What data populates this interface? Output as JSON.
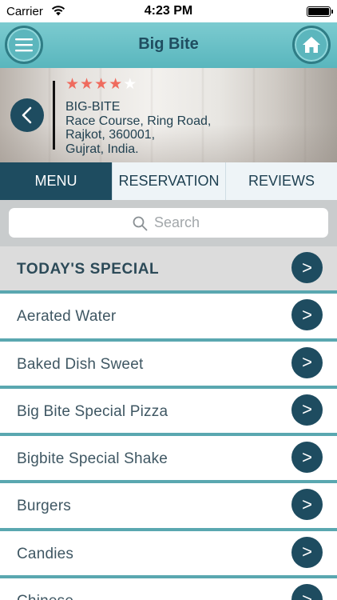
{
  "status_bar": {
    "carrier": "Carrier",
    "time": "4:23 PM"
  },
  "header": {
    "title": "Big Bite",
    "menu_icon": "hamburger-icon",
    "home_icon": "home-icon"
  },
  "restaurant": {
    "rating": 4,
    "rating_max": 5,
    "address_lines": [
      "BIG-BITE",
      "Race Course, Ring Road,",
      "Rajkot, 360001,",
      "Gujrat, India."
    ]
  },
  "tabs": [
    {
      "label": "MENU",
      "active": true
    },
    {
      "label": "RESERVATION",
      "active": false
    },
    {
      "label": "REVIEWS",
      "active": false
    }
  ],
  "search": {
    "placeholder": "Search"
  },
  "menu": {
    "arrow_glyph": ">",
    "items": [
      "TODAY'S SPECIAL",
      "Aerated Water",
      "Baked Dish Sweet",
      "Big Bite Special Pizza",
      "Bigbite Special Shake",
      "Burgers",
      "Candies",
      "Chinese"
    ]
  },
  "colors": {
    "header_teal": "#5cb6bd",
    "navy": "#1e4c60",
    "star_red": "#ef6b5e",
    "divider_teal": "#5aa7b0"
  }
}
